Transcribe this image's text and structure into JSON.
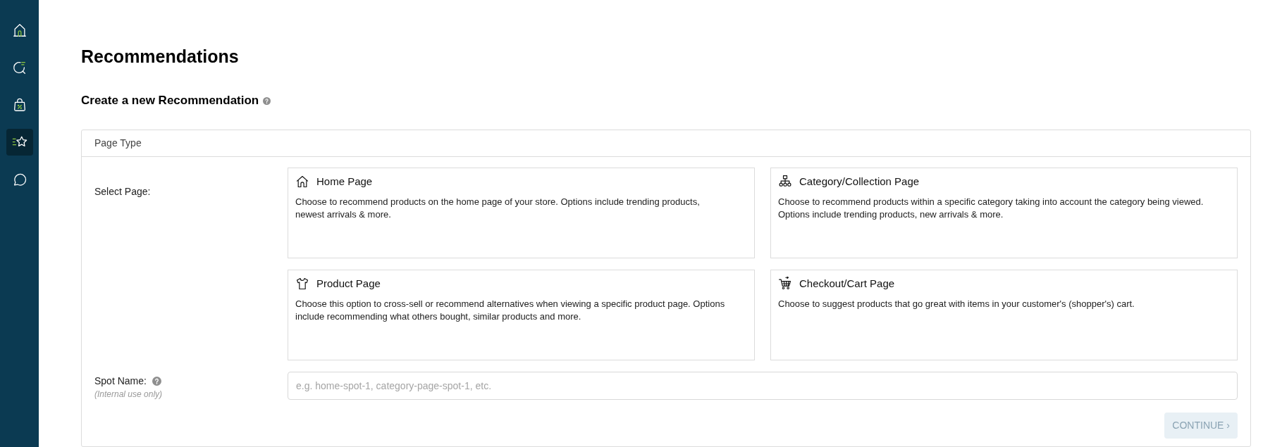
{
  "sidebar": {
    "items": [
      {
        "kind": "home",
        "selected": false
      },
      {
        "kind": "search",
        "selected": false
      },
      {
        "kind": "bag",
        "selected": false
      },
      {
        "kind": "star",
        "selected": true
      },
      {
        "kind": "chat",
        "selected": false
      }
    ]
  },
  "page": {
    "title": "Recommendations",
    "subtitle": "Create a new Recommendation"
  },
  "panel": {
    "header": "Page Type",
    "select_label": "Select Page:",
    "options": [
      {
        "kind": "home",
        "title": "Home Page",
        "description": "Choose to recommend products on the home page of your store. Options include trending products, newest arrivals & more."
      },
      {
        "kind": "category",
        "title": "Category/Collection Page",
        "description": "Choose to recommend products within a specific category taking into account the category being viewed. Options include trending products, new arrivals & more."
      },
      {
        "kind": "product",
        "title": "Product Page",
        "description": "Choose this option to cross-sell or recommend alternatives when viewing a specific product page. Options include recommending what others bought, similar products and more."
      },
      {
        "kind": "cart",
        "title": "Checkout/Cart Page",
        "description": "Choose to suggest products that go great with items in your customer's (shopper's) cart."
      }
    ],
    "spot_name": {
      "label": "Spot Name:",
      "hint": "(Internal use only)",
      "placeholder": "e.g. home-spot-1, category-page-spot-1, etc."
    },
    "continue_button": {
      "label": "CONTINUE ›",
      "disabled": true
    }
  }
}
